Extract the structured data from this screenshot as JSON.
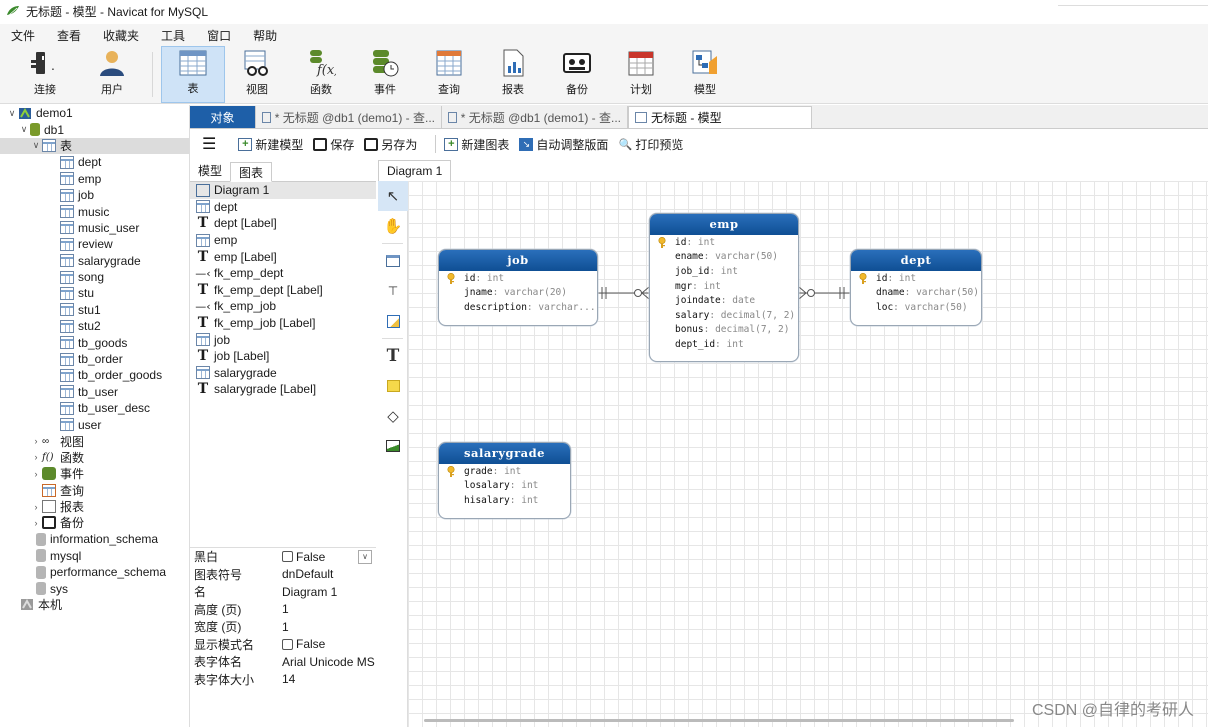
{
  "window": {
    "title": "无标题 - 模型 - Navicat for MySQL"
  },
  "menu": [
    "文件",
    "查看",
    "收藏夹",
    "工具",
    "窗口",
    "帮助"
  ],
  "toolbar": [
    {
      "label": "连接",
      "icon": "plug-icon"
    },
    {
      "label": "用户",
      "icon": "user-icon"
    },
    {
      "label": "表",
      "icon": "table-icon"
    },
    {
      "label": "视图",
      "icon": "view-icon"
    },
    {
      "label": "函数",
      "icon": "function-icon"
    },
    {
      "label": "事件",
      "icon": "event-icon"
    },
    {
      "label": "查询",
      "icon": "query-icon"
    },
    {
      "label": "报表",
      "icon": "report-icon"
    },
    {
      "label": "备份",
      "icon": "backup-icon"
    },
    {
      "label": "计划",
      "icon": "schedule-icon"
    },
    {
      "label": "模型",
      "icon": "model-icon"
    }
  ],
  "tree": {
    "connection": "demo1",
    "database": "db1",
    "tables_node": "表",
    "tables": [
      "dept",
      "emp",
      "job",
      "music",
      "music_user",
      "review",
      "salarygrade",
      "song",
      "stu",
      "stu1",
      "stu2",
      "tb_goods",
      "tb_order",
      "tb_order_goods",
      "tb_user",
      "tb_user_desc",
      "user"
    ],
    "others": [
      "视图",
      "函数",
      "事件",
      "查询",
      "报表",
      "备份"
    ],
    "dbs": [
      "information_schema",
      "mysql",
      "performance_schema",
      "sys"
    ],
    "local": "本机"
  },
  "tabs": [
    {
      "label": "对象"
    },
    {
      "label": "* 无标题 @db1 (demo1) - 查..."
    },
    {
      "label": "* 无标题 @db1 (demo1) - 查..."
    },
    {
      "label": "无标题 - 模型"
    }
  ],
  "editor_toolbar": {
    "new_model": "新建模型",
    "save": "保存",
    "save_as": "另存为",
    "new_diagram": "新建图表",
    "auto_layout": "自动调整版面",
    "print_preview": "打印预览"
  },
  "object_panel": {
    "tabs": [
      "模型",
      "图表"
    ],
    "items": [
      {
        "label": "Diagram 1",
        "kind": "diagram"
      },
      {
        "label": "dept",
        "kind": "table"
      },
      {
        "label": "dept [Label]",
        "kind": "label"
      },
      {
        "label": "emp",
        "kind": "table"
      },
      {
        "label": "emp [Label]",
        "kind": "label"
      },
      {
        "label": "fk_emp_dept",
        "kind": "fk"
      },
      {
        "label": "fk_emp_dept [Label]",
        "kind": "label"
      },
      {
        "label": "fk_emp_job",
        "kind": "fk"
      },
      {
        "label": "fk_emp_job [Label]",
        "kind": "label"
      },
      {
        "label": "job",
        "kind": "table"
      },
      {
        "label": "job [Label]",
        "kind": "label"
      },
      {
        "label": "salarygrade",
        "kind": "table"
      },
      {
        "label": "salarygrade [Label]",
        "kind": "label"
      }
    ]
  },
  "properties": [
    {
      "key": "黑白",
      "value": "False",
      "checkbox": true,
      "dropdown": true
    },
    {
      "key": "图表符号",
      "value": "dnDefault"
    },
    {
      "key": "名",
      "value": "Diagram 1"
    },
    {
      "key": "高度 (页)",
      "value": "1"
    },
    {
      "key": "宽度 (页)",
      "value": "1"
    },
    {
      "key": "显示模式名",
      "value": "False",
      "checkbox": true
    },
    {
      "key": "表字体名",
      "value": "Arial Unicode MS"
    },
    {
      "key": "表字体大小",
      "value": "14"
    }
  ],
  "diagram_tab": "Diagram 1",
  "entities": {
    "job": {
      "name": "job",
      "fields": [
        {
          "name": "id",
          "type": "int",
          "pk": true
        },
        {
          "name": "jname",
          "type": "varchar(20)"
        },
        {
          "name": "description",
          "type": "varchar..."
        }
      ]
    },
    "emp": {
      "name": "emp",
      "fields": [
        {
          "name": "id",
          "type": "int",
          "pk": true
        },
        {
          "name": "ename",
          "type": "varchar(50)"
        },
        {
          "name": "job_id",
          "type": "int"
        },
        {
          "name": "mgr",
          "type": "int"
        },
        {
          "name": "joindate",
          "type": "date"
        },
        {
          "name": "salary",
          "type": "decimal(7, 2)"
        },
        {
          "name": "bonus",
          "type": "decimal(7, 2)"
        },
        {
          "name": "dept_id",
          "type": "int"
        }
      ]
    },
    "dept": {
      "name": "dept",
      "fields": [
        {
          "name": "id",
          "type": "int",
          "pk": true
        },
        {
          "name": "dname",
          "type": "varchar(50)"
        },
        {
          "name": "loc",
          "type": "varchar(50)"
        }
      ]
    },
    "salarygrade": {
      "name": "salarygrade",
      "fields": [
        {
          "name": "grade",
          "type": "int",
          "pk": true
        },
        {
          "name": "losalary",
          "type": "int"
        },
        {
          "name": "hisalary",
          "type": "int"
        }
      ]
    }
  },
  "watermark": "CSDN @自律的考研人"
}
